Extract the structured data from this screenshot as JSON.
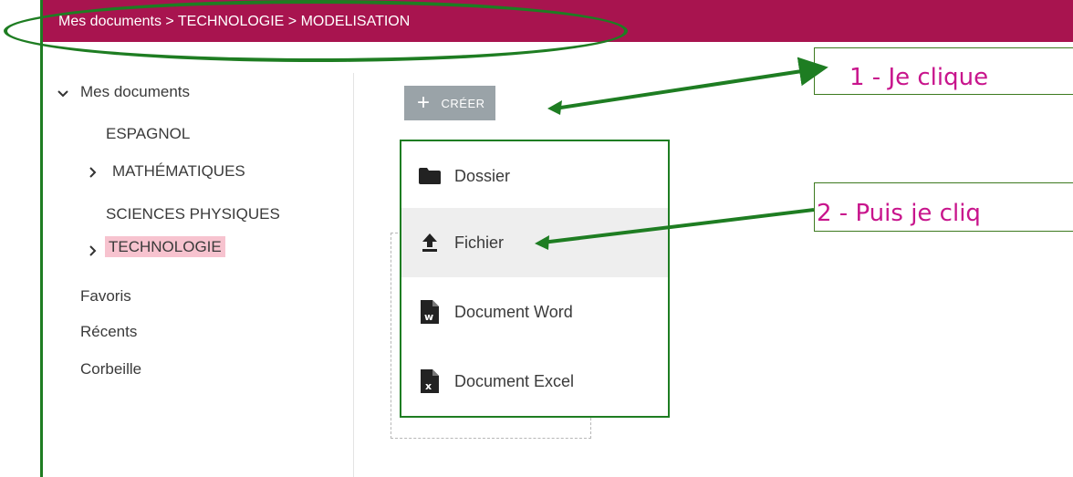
{
  "header": {
    "breadcrumb": "Mes documents > TECHNOLOGIE > MODELISATION",
    "color": "#a8144f"
  },
  "sidebar": {
    "root_label": "Mes documents",
    "root_icon": "chevron-down-icon",
    "folders": [
      {
        "label": "ESPAGNOL"
      },
      {
        "label": "MATHÉMATIQUES",
        "icon": "chevron-right-icon"
      },
      {
        "label": "SCIENCES PHYSIQUES"
      },
      {
        "label": "TECHNOLOGIE",
        "icon": "chevron-right-icon",
        "selected": true
      }
    ],
    "favorites": "Favoris",
    "recent": "Récents",
    "trash": "Corbeille"
  },
  "toolbar": {
    "create_label": "CRÉER",
    "create_icon": "plus-icon"
  },
  "create_menu": {
    "items": [
      {
        "label": "Dossier",
        "icon": "folder-icon"
      },
      {
        "label": "Fichier",
        "icon": "upload-icon"
      },
      {
        "label": "Document Word",
        "icon": "word-document-icon"
      },
      {
        "label": "Document Excel",
        "icon": "excel-document-icon"
      }
    ]
  },
  "annotations": {
    "callout1": "1 - Je clique",
    "callout2": "2 - Puis je cliq",
    "annotation_color": "#1e7d22",
    "callout_text_color": "#c8158c"
  }
}
